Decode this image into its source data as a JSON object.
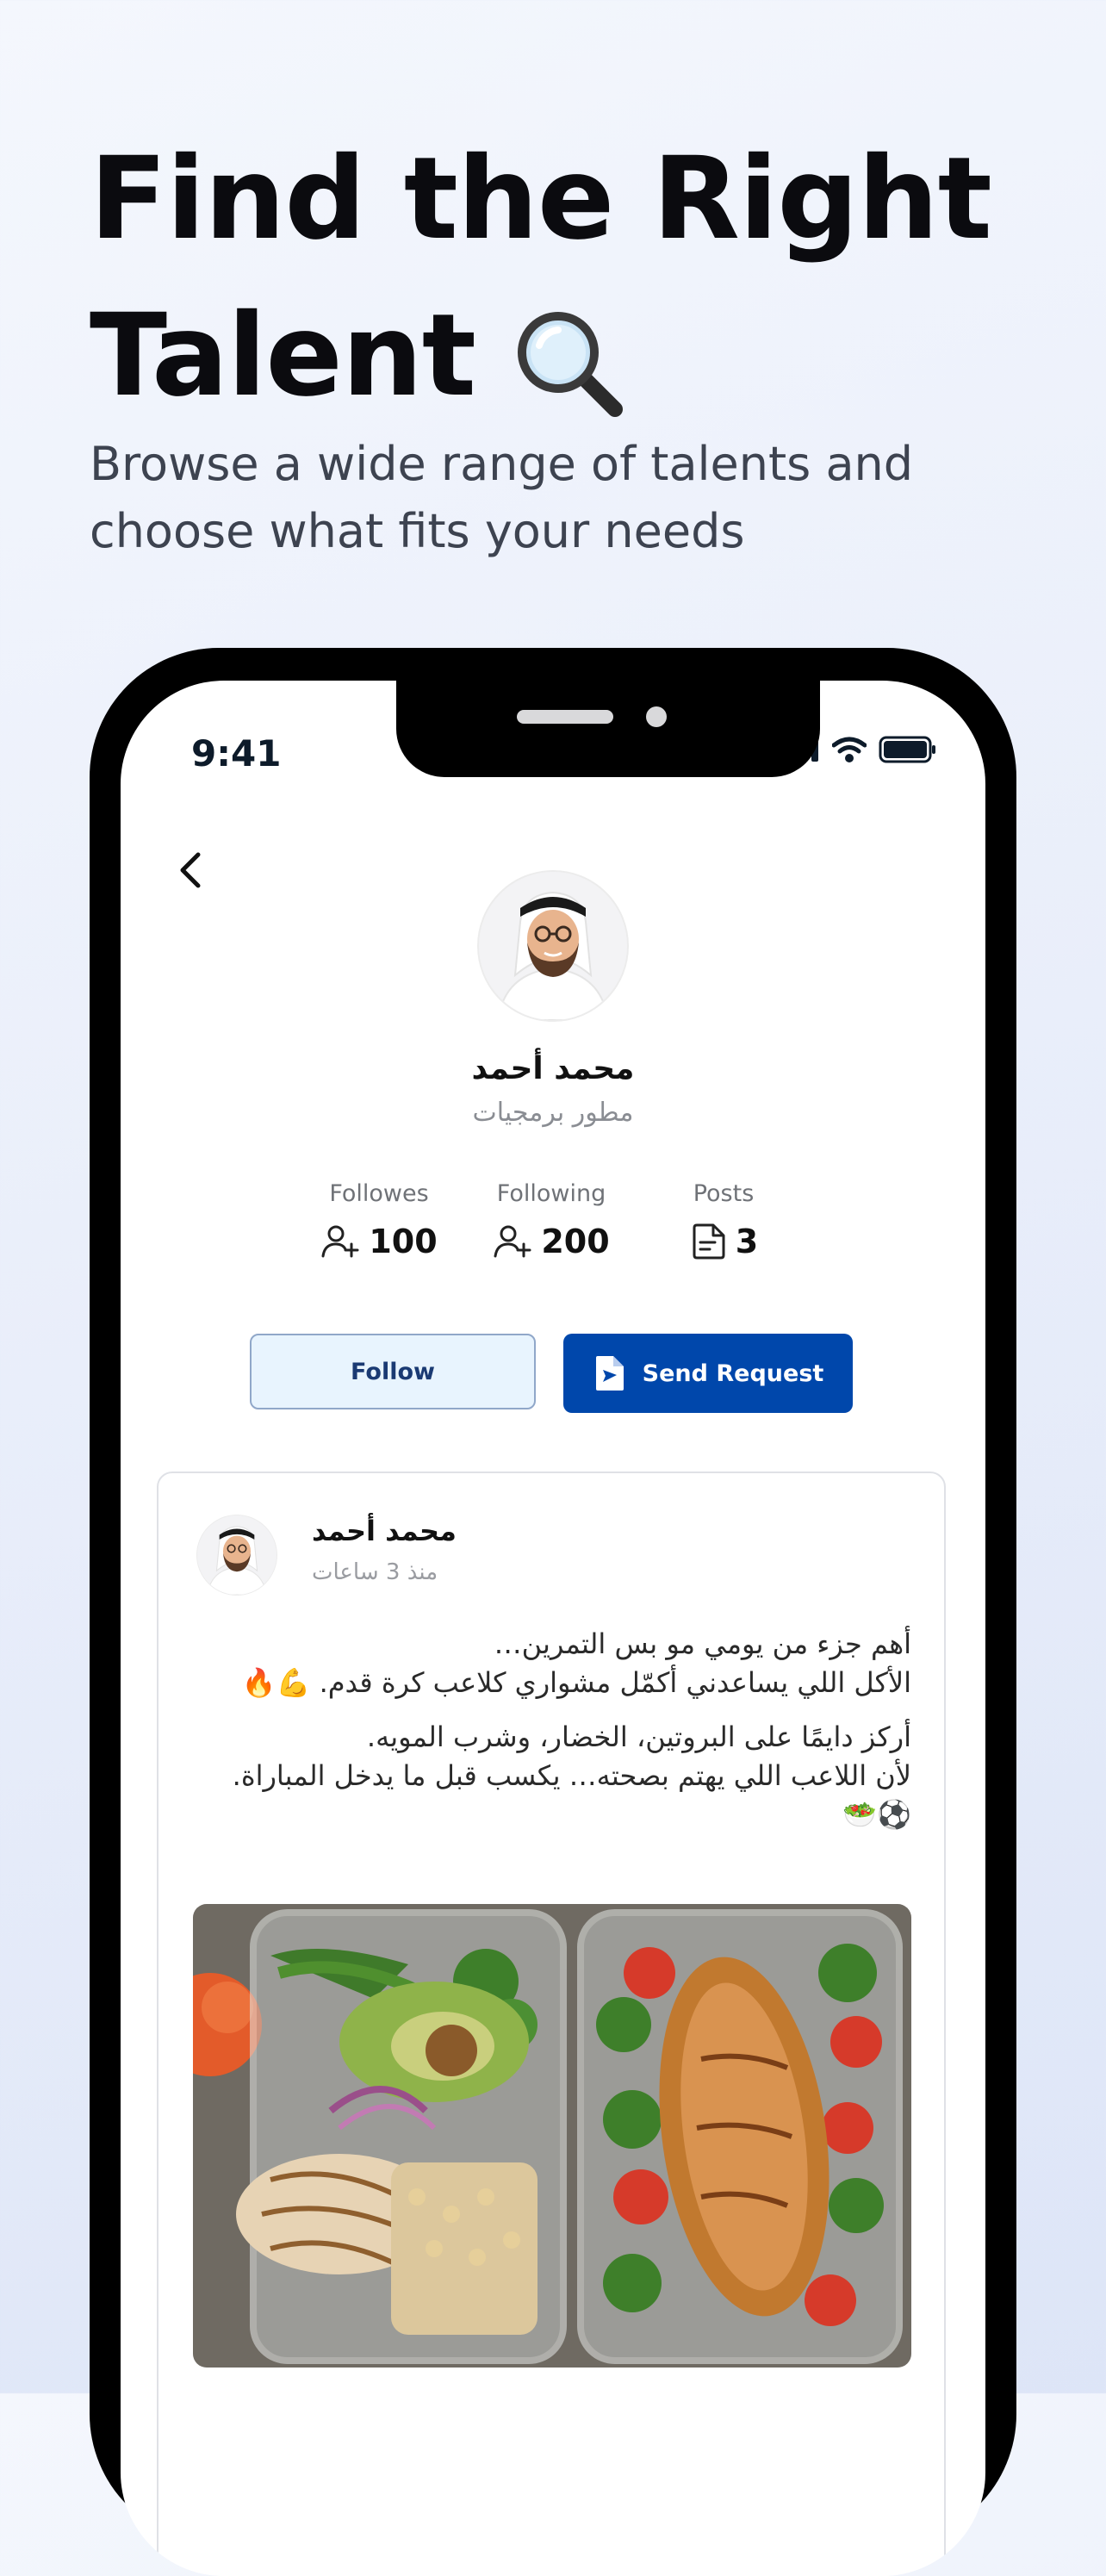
{
  "hero": {
    "title_line1": "Find the Right",
    "title_line2": "Talent",
    "subtitle": "Browse a wide range of talents and choose what fits your needs"
  },
  "status_bar": {
    "time": "9:41"
  },
  "profile": {
    "name": "محمد أحمد",
    "role": "مطور برمجيات",
    "stats": [
      {
        "label": "Followes",
        "value": "100",
        "icon": "add-user-icon"
      },
      {
        "label": "Following",
        "value": "200",
        "icon": "add-user-icon"
      },
      {
        "label": "Posts",
        "value": "3",
        "icon": "document-icon"
      }
    ],
    "buttons": {
      "follow": "Follow",
      "send_request": "Send Request"
    }
  },
  "post": {
    "author": "محمد أحمد",
    "time": "منذ 3 ساعات",
    "lines": [
      "أهم جزء من يومي مو بس التمرين…",
      "الأكل اللي يساعدني أكمّل مشواري كلاعب كرة قدم. 💪🔥",
      "أركز دايمًا على البروتين، الخضار، وشرب المويه.",
      "لأن اللاعب اللي يهتم بصحته… يكسب قبل ما يدخل المباراة. ⚽🥗"
    ]
  },
  "colors": {
    "accent": "#0047ab",
    "follow_bg": "#e8f4fe",
    "follow_border": "#90a7c9",
    "title": "#0b0b0f",
    "subtitle": "#3d4350"
  }
}
